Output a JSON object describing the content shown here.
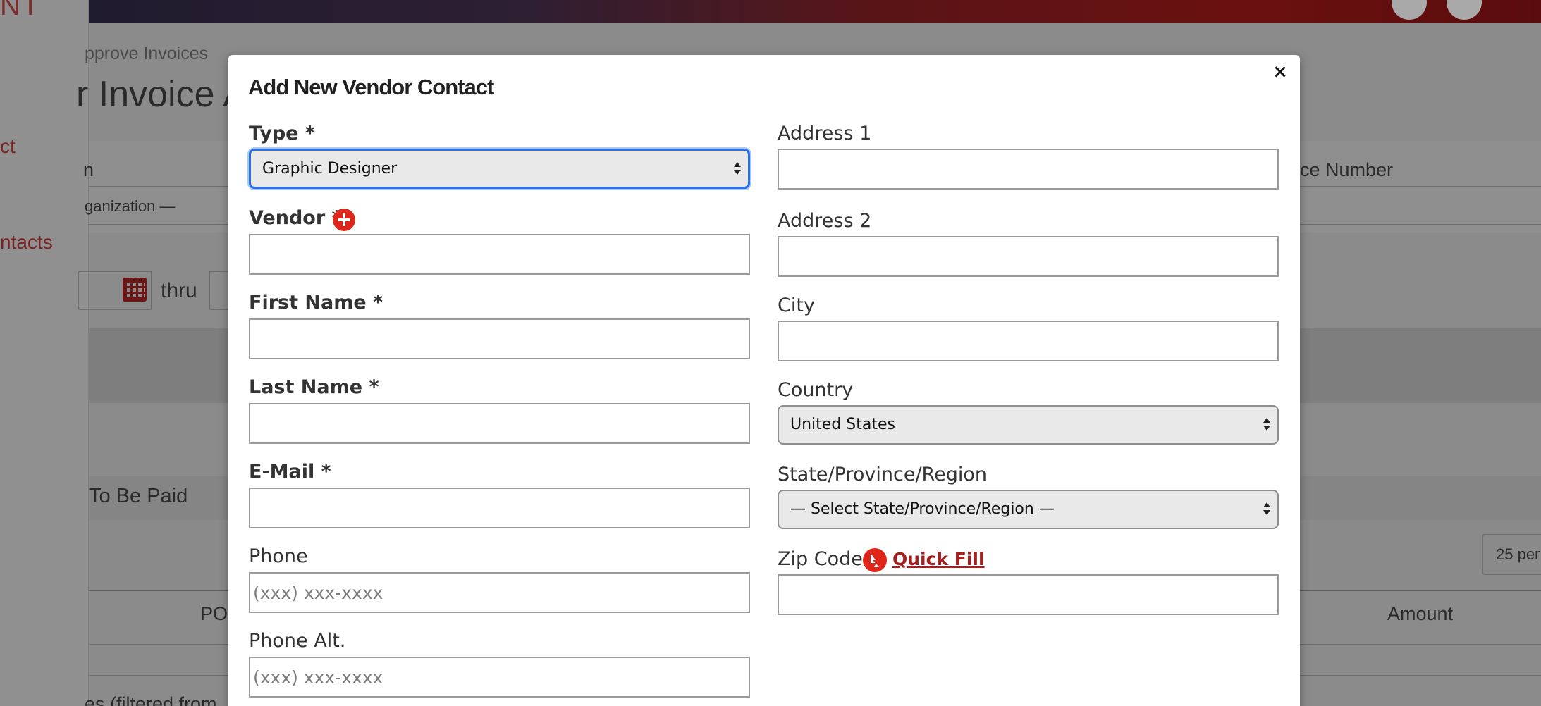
{
  "background": {
    "logo_fragment": "NT",
    "header_colors": [
      "#1f1b2e",
      "#5a1416",
      "#6b1010"
    ],
    "sidebar_links": [
      "ct",
      "ntacts"
    ],
    "breadcrumb": "pprove Invoices",
    "page_title": "r Invoice A",
    "filter_left_label": "n",
    "filter_left_value": "ganization —",
    "filter_right_label": "ce Number",
    "date_thru": "thru",
    "section_label": "To Be Paid",
    "per_page": "25 per",
    "col_po": "PO",
    "col_amount": "Amount",
    "footer_fragment": "es (filtered from"
  },
  "modal": {
    "title": "Add New Vendor Contact",
    "close_label": "×",
    "left": {
      "type_label": "Type *",
      "type_value": "Graphic Designer",
      "vendor_label": "Vendor *",
      "first_name_label": "First Name *",
      "last_name_label": "Last Name *",
      "email_label": "E-Mail *",
      "phone_label": "Phone",
      "phone_placeholder": "(xxx) xxx-xxxx",
      "phone_alt_label": "Phone Alt.",
      "phone_alt_placeholder": "(xxx) xxx-xxxx"
    },
    "right": {
      "address1_label": "Address 1",
      "address2_label": "Address 2",
      "city_label": "City",
      "country_label": "Country",
      "country_value": "United States",
      "state_label": "State/Province/Region",
      "state_value": "— Select State/Province/Region —",
      "zip_label": "Zip Code",
      "quick_fill_label": "Quick Fill"
    },
    "colors": {
      "accent_red": "#e0251b",
      "focus_blue": "#2a70e3",
      "link_red": "#a22020"
    }
  }
}
